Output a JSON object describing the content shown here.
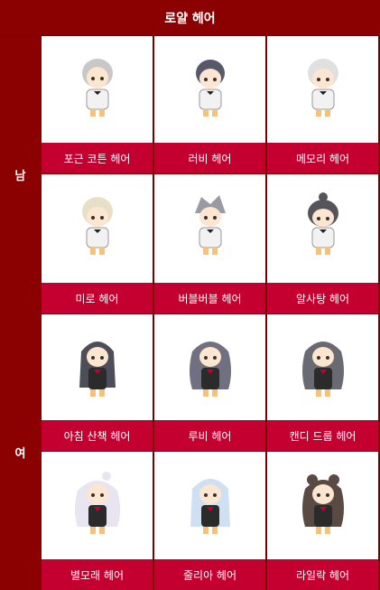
{
  "title": "로얄 헤어",
  "sections": [
    {
      "label": "남",
      "items": [
        "포근 코튼 헤어",
        "러비 헤어",
        "메모리 헤어",
        "미로 헤어",
        "버블버블 헤어",
        "알사탕 헤어"
      ]
    },
    {
      "label": "여",
      "items": [
        "아침 산책 헤어",
        "루비 헤어",
        "캔디 드룹 헤어",
        "별모래 헤어",
        "줄리아 헤어",
        "라일락 헤어"
      ]
    }
  ],
  "colors": {
    "frame": "#8b0000",
    "label_bg": "#c3002f"
  }
}
